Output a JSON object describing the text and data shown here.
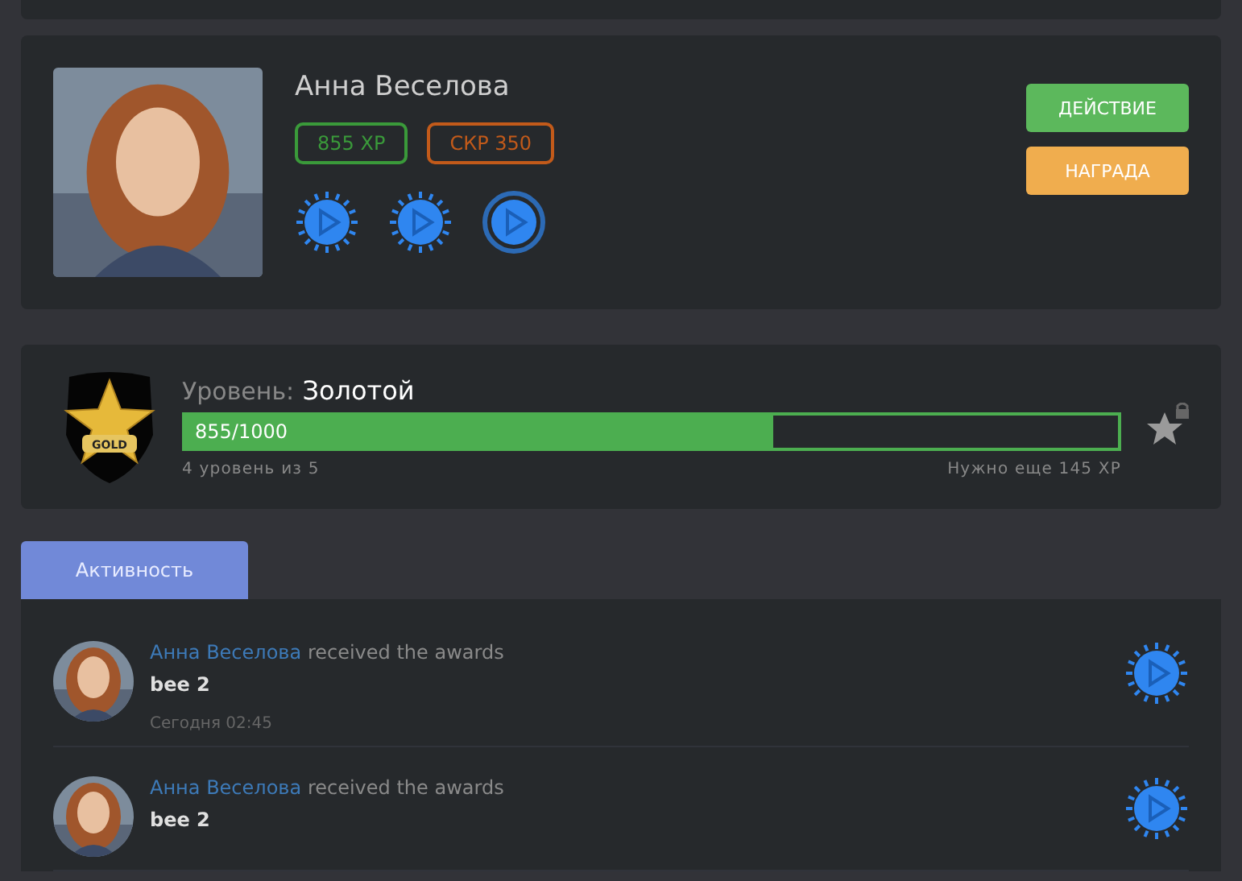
{
  "profile": {
    "name": "Анна Веселова",
    "tags": [
      {
        "label": "855 XP",
        "color": "#3a9a3a"
      },
      {
        "label": "СКР 350",
        "color": "#c25a1a"
      }
    ],
    "badges": [
      {
        "kind": "burst"
      },
      {
        "kind": "burst"
      },
      {
        "kind": "ring"
      }
    ],
    "buttons": [
      {
        "label": "ДЕЙСТВИЕ",
        "color": "#5cb85c"
      },
      {
        "label": "НАГРАДА",
        "color": "#f0ad4e"
      }
    ]
  },
  "level": {
    "caption": "Уровень:",
    "name": "Золотой",
    "medal": "GOLD",
    "progress": "855/1000",
    "level": 0.63,
    "steps": "4 уровень из 5",
    "remaining": "Нужно еще 145 XP"
  },
  "tabs": [
    {
      "label": "Активность",
      "selected": true
    }
  ],
  "activity": [
    {
      "user": "Анна Веселова",
      "action": "received the awards",
      "award": "bee 2",
      "time": "Сегодня 02:45"
    },
    {
      "user": "Анна Веселова",
      "action": "received the awards",
      "award": "bee 2"
    }
  ]
}
